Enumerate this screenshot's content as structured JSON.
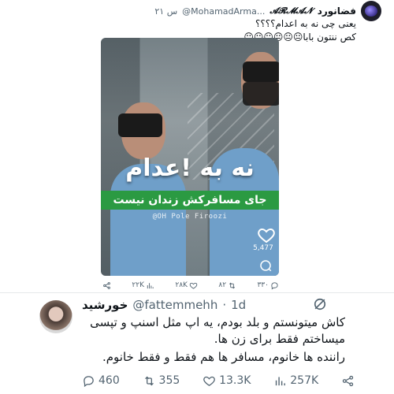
{
  "quoted": {
    "display_name": "فضانورد",
    "brand": "𝓐𝓡𝓜𝓐𝓝",
    "handle": "@MohamadArma...",
    "time": "۲۱ س",
    "text_line1": "یعنی چی نه به اعدام؟؟؟؟",
    "text_line2": "کص ننتون بابا😐😐😐😐😐😐",
    "media": {
      "overlay_title": "نه به !عدام",
      "banner_text": "جای مسافرکش زندان نیست",
      "watermark": "@OH Pole Firoozi",
      "likes": "5,477"
    },
    "actions": {
      "replies": "۳۳۰",
      "retweets": "۸۲",
      "likes": "۲۸K",
      "views": "۲۲K"
    }
  },
  "reply": {
    "display_name": "خورشید",
    "handle": "@fattemmehh",
    "time": "1d",
    "body_line1": "کاش میتونستم و بلد بودم، یه اپ مثل اسنپ و تپسی",
    "body_line2": "میساختم فقط برای زن ها.",
    "body_line3": "راننده ها خانوم، مسافر ها هم فقط و فقط خانوم.",
    "actions": {
      "replies": "460",
      "retweets": "355",
      "likes": "13.3K",
      "views": "257K"
    }
  },
  "colors": {
    "text": "#0f1419",
    "secondary": "#536471",
    "banner_green": "#2b9a42"
  },
  "icons": [
    "avatar",
    "heart-icon",
    "chat-icon",
    "share-icon",
    "views-icon",
    "retweet-icon",
    "reply-icon",
    "grok-icon"
  ]
}
